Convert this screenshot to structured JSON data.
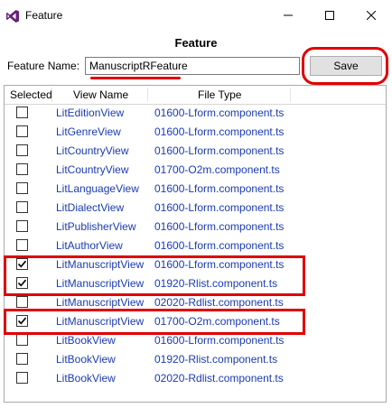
{
  "window": {
    "title": "Feature",
    "icon": "visual-studio-icon",
    "controls": [
      "minimize-icon",
      "maximize-icon",
      "close-icon"
    ]
  },
  "header": {
    "title": "Feature"
  },
  "form": {
    "feature_name_label": "Feature Name:",
    "feature_name_value": "ManuscriptRFeature",
    "save_label": "Save"
  },
  "grid": {
    "columns": [
      "Selected",
      "View Name",
      "File Type"
    ],
    "rows": [
      {
        "selected": false,
        "view": "LitEditionView",
        "file": "01600-Lform.component.ts"
      },
      {
        "selected": false,
        "view": "LitGenreView",
        "file": "01600-Lform.component.ts"
      },
      {
        "selected": false,
        "view": "LitCountryView",
        "file": "01600-Lform.component.ts"
      },
      {
        "selected": false,
        "view": "LitCountryView",
        "file": "01700-O2m.component.ts"
      },
      {
        "selected": false,
        "view": "LitLanguageView",
        "file": "01600-Lform.component.ts"
      },
      {
        "selected": false,
        "view": "LitDialectView",
        "file": "01600-Lform.component.ts"
      },
      {
        "selected": false,
        "view": "LitPublisherView",
        "file": "01600-Lform.component.ts"
      },
      {
        "selected": false,
        "view": "LitAuthorView",
        "file": "01600-Lform.component.ts"
      },
      {
        "selected": true,
        "view": "LitManuscriptView",
        "file": "01600-Lform.component.ts"
      },
      {
        "selected": true,
        "view": "LitManuscriptView",
        "file": "01920-Rlist.component.ts"
      },
      {
        "selected": false,
        "view": "LitManuscriptView",
        "file": "02020-Rdlist.component.ts"
      },
      {
        "selected": true,
        "view": "LitManuscriptView",
        "file": "01700-O2m.component.ts"
      },
      {
        "selected": false,
        "view": "LitBookView",
        "file": "01600-Lform.component.ts"
      },
      {
        "selected": false,
        "view": "LitBookView",
        "file": "01920-Rlist.component.ts"
      },
      {
        "selected": false,
        "view": "LitBookView",
        "file": "02020-Rdlist.component.ts"
      }
    ]
  },
  "colors": {
    "highlight": "#e00000",
    "link_text": "#1a3bb3",
    "vs_purple": "#68217a"
  }
}
